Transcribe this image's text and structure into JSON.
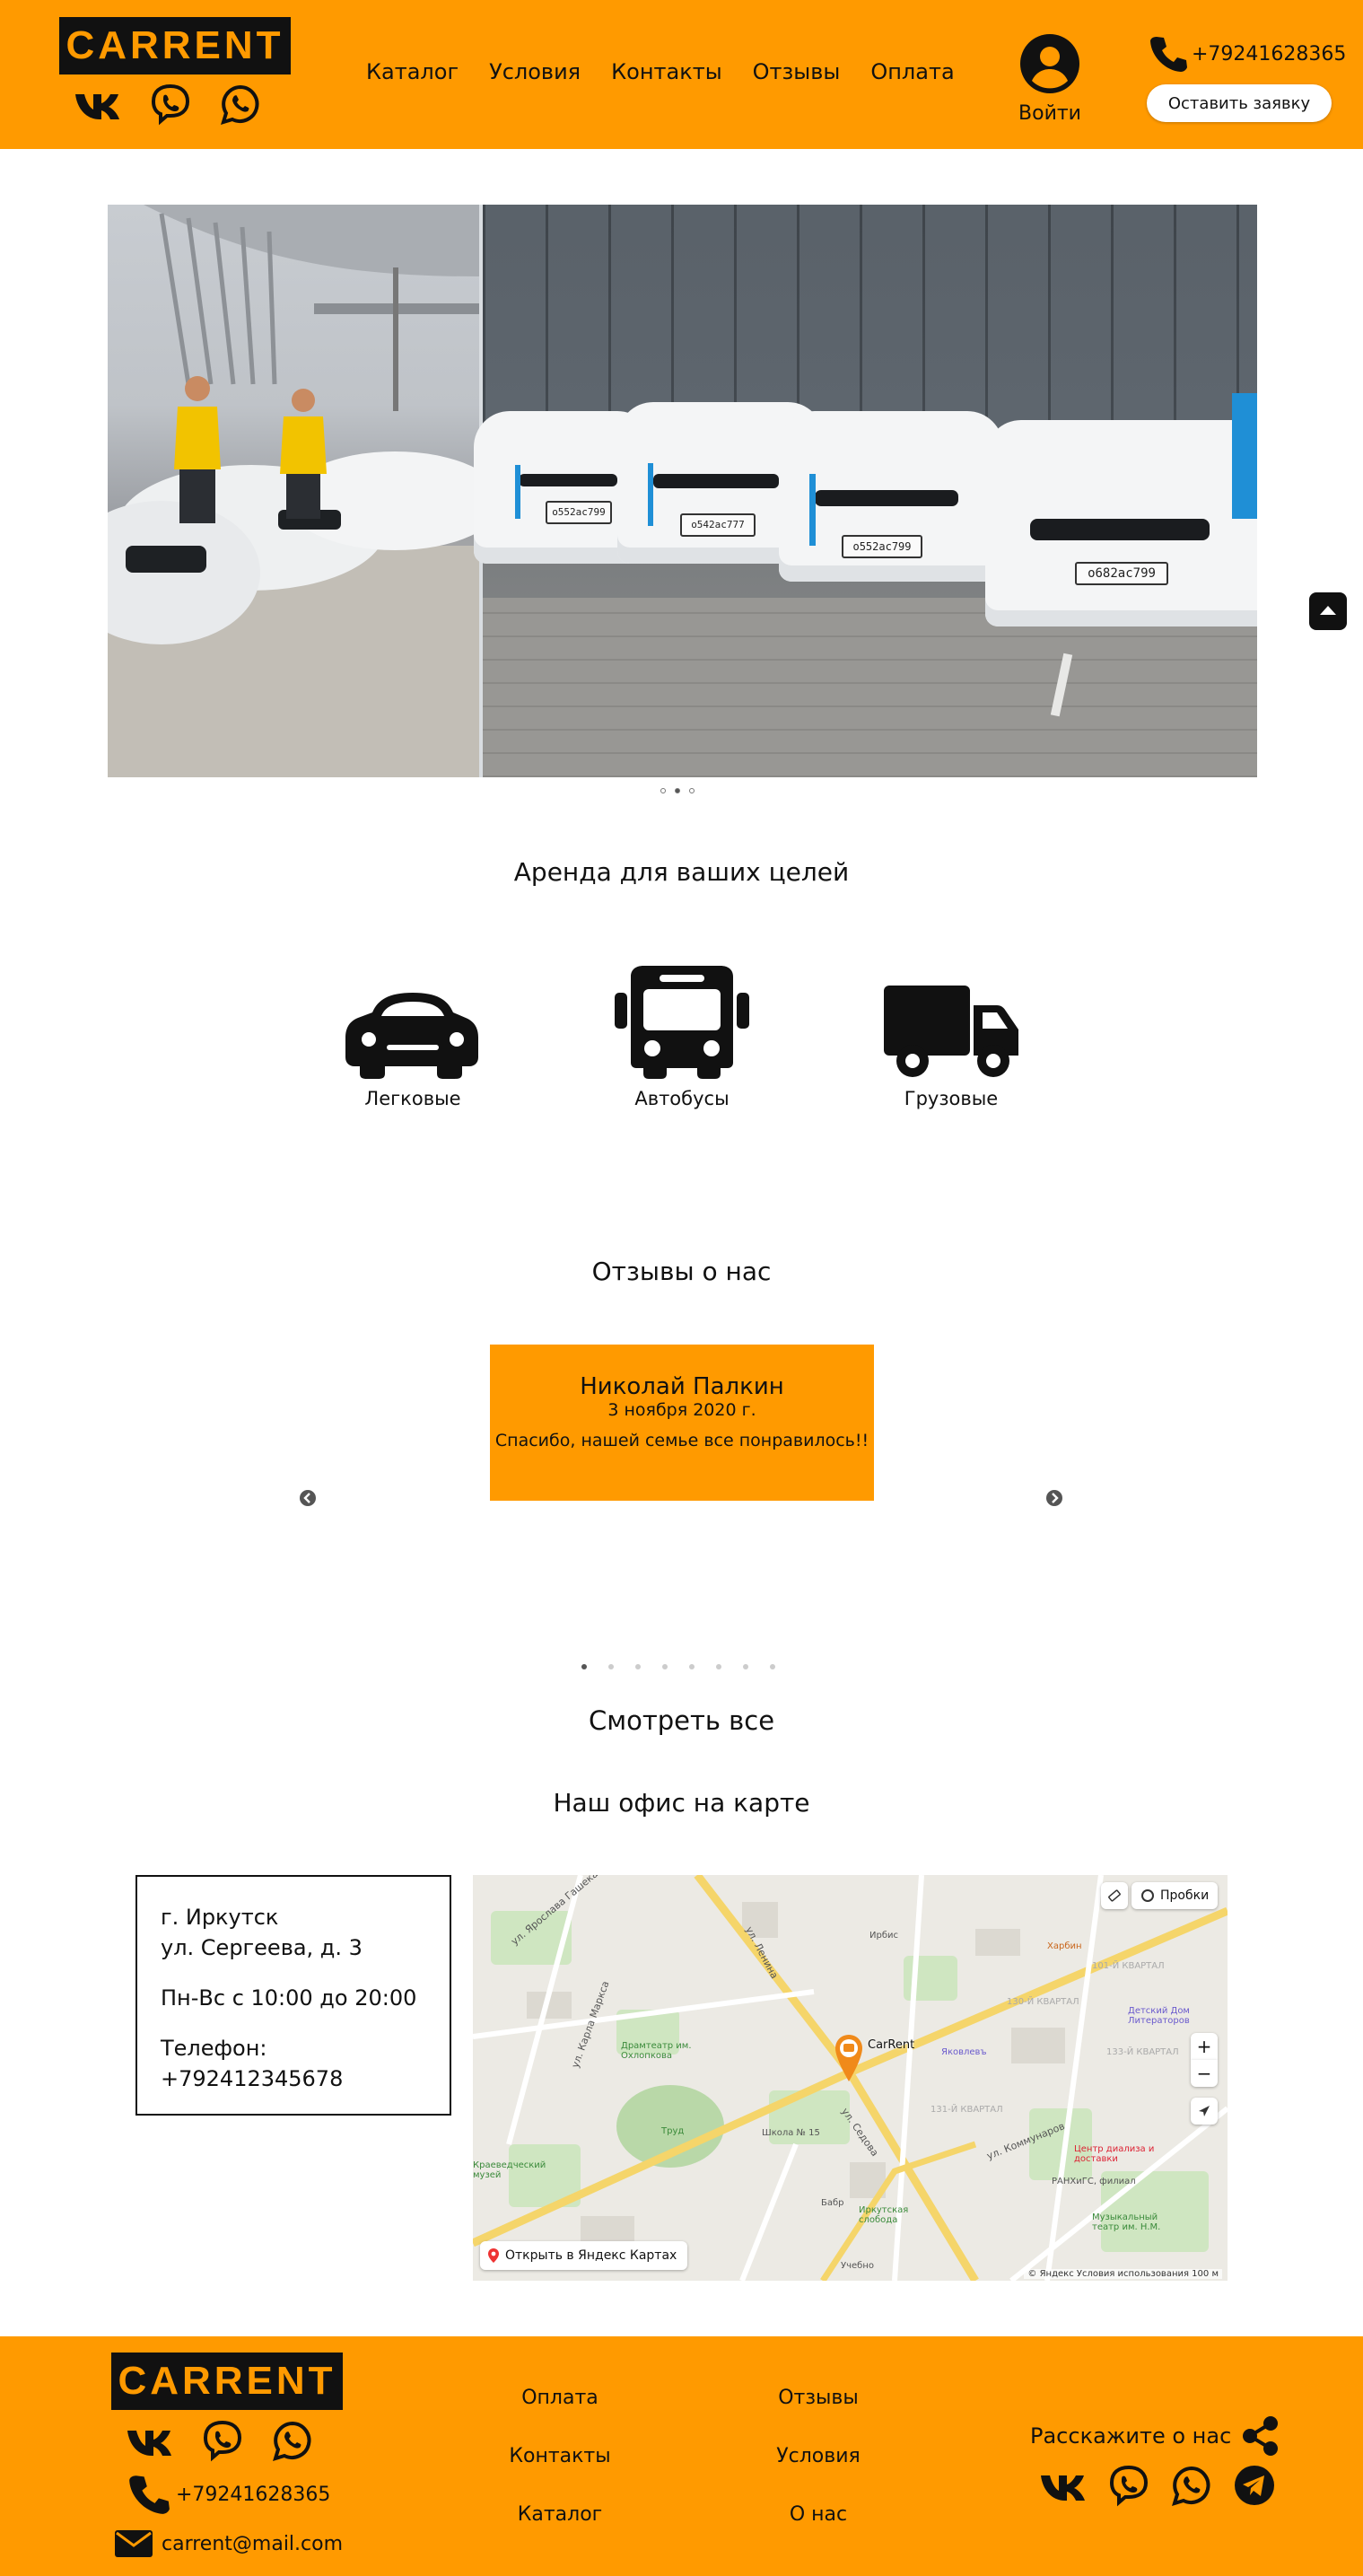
{
  "brand": {
    "logo": "CARRENT",
    "accent": "#ff9a00",
    "dark": "#111111"
  },
  "header": {
    "nav": [
      "Каталог",
      "Условия",
      "Контакты",
      "Отзывы",
      "Оплата"
    ],
    "login_label": "Войти",
    "phone": "+79241628365",
    "request_button": "Оставить заявку",
    "socials": [
      "vk-icon",
      "viber-icon",
      "whatsapp-icon"
    ]
  },
  "slider": {
    "plates": [
      "о552ас799",
      "о542ас777",
      "о552ас799",
      "о682ас799"
    ],
    "dots": 3,
    "active_dot": 1
  },
  "categories": {
    "title": "Аренда для ваших целей",
    "items": [
      {
        "label": "Легковые",
        "icon": "car-icon"
      },
      {
        "label": "Автобусы",
        "icon": "bus-icon"
      },
      {
        "label": "Грузовые",
        "icon": "truck-icon"
      }
    ]
  },
  "reviews": {
    "title": "Отзывы о нас",
    "current": {
      "name": "Николай Палкин",
      "date": "3 ноября 2020 г.",
      "text": "Спасибо, нашей семье все понравилось!!"
    },
    "dots": 8,
    "active_dot": 0,
    "see_all": "Смотреть все"
  },
  "office": {
    "title": "Наш офис на карте",
    "city": "г. Иркутск",
    "street": "ул. Сергеева, д. 3",
    "hours": "Пн-Вс с 10:00 до 20:00",
    "phone_label": "Телефон:",
    "phone": "+792412345678"
  },
  "map": {
    "traffic_label": "Пробки",
    "marker_label": "CarRent",
    "open_label": "Открыть в Яндекс Картах",
    "copyright": "© Яндекс  Условия использования  100 м",
    "zoom_in": "+",
    "zoom_out": "−",
    "labels": [
      "ул. Ярослава Гашека",
      "ул. Ленина",
      "ул. Седова",
      "ул. Карла Маркса",
      "ул. Коммунаров",
      "Драмтеатр им. Охлопкова",
      "Труд",
      "Школа № 15",
      "Иркутская слобода",
      "Харбин",
      "Яковлевъ",
      "101-Й КВАРТАЛ",
      "130-Й КВАРТАЛ",
      "133-Й КВАРТАЛ",
      "131-Й КВАРТАЛ",
      "Краеведческий музей",
      "Центр диализа и доставки",
      "РАНХиГС, филиал",
      "Музыкальный театр им. Н.М.",
      "Ирбис",
      "Детский Дом Литераторов",
      "Учебно",
      "Бабр"
    ]
  },
  "footer": {
    "phone": "+79241628365",
    "email": "carrent@mail.com",
    "links_col1": [
      "Оплата",
      "Контакты",
      "Каталог"
    ],
    "links_col2": [
      "Отзывы",
      "Условия",
      "О нас"
    ],
    "share_label": "Расскажите о нас",
    "share_socials": [
      "vk-icon",
      "viber-icon",
      "whatsapp-icon",
      "telegram-icon"
    ]
  }
}
